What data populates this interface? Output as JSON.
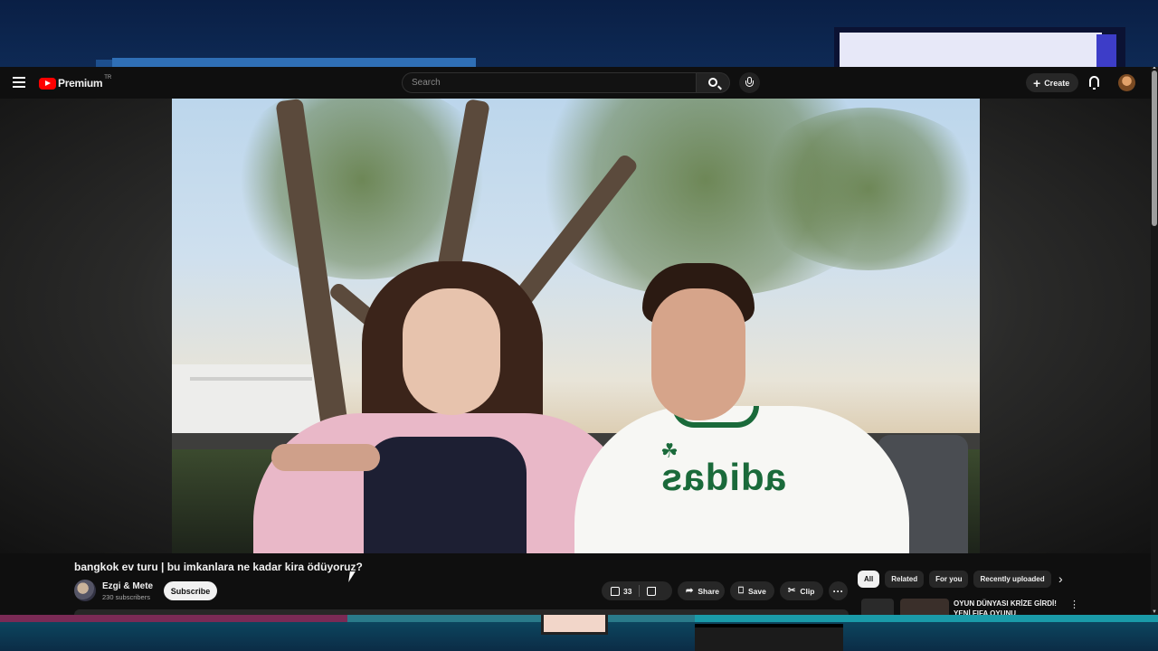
{
  "header": {
    "logo_text": "Premium",
    "region": "TR",
    "search_placeholder": "Search",
    "create_label": "Create"
  },
  "video": {
    "title": "bangkok ev turu | bu imkanlara ne kadar kira ödüyoruz?",
    "channel_name": "Ezgi & Mete",
    "subscribers": "230 subscribers",
    "subscribe_label": "Subscribe",
    "like_count": "33",
    "share_label": "Share",
    "save_label": "Save",
    "clip_label": "Clip",
    "more_label": "···",
    "shirt_text": "adidas",
    "shirt_logo": "☘"
  },
  "recommendations": {
    "chips": [
      "All",
      "Related",
      "For you",
      "Recently uploaded"
    ],
    "active_chip": "All",
    "first_item_title": "OYUN DÜNYASI KRİZE GİRDİ! YENİ FIFA OYUNU DUYURULD..."
  },
  "icons": {
    "menu": "menu-icon",
    "logo": "youtube-logo-icon",
    "search": "search-icon",
    "mic": "mic-icon",
    "create": "plus-icon",
    "notifications": "bell-icon",
    "like": "thumbs-up-icon",
    "dislike": "thumbs-down-icon",
    "share": "share-arrow-icon",
    "save": "bookmark-icon",
    "clip": "scissors-icon",
    "chips_next": "chevron-right-icon"
  },
  "colors": {
    "brand_red": "#ff0000",
    "background": "#0f0f0f",
    "pill": "#272727",
    "text": "#f1f1f1"
  }
}
